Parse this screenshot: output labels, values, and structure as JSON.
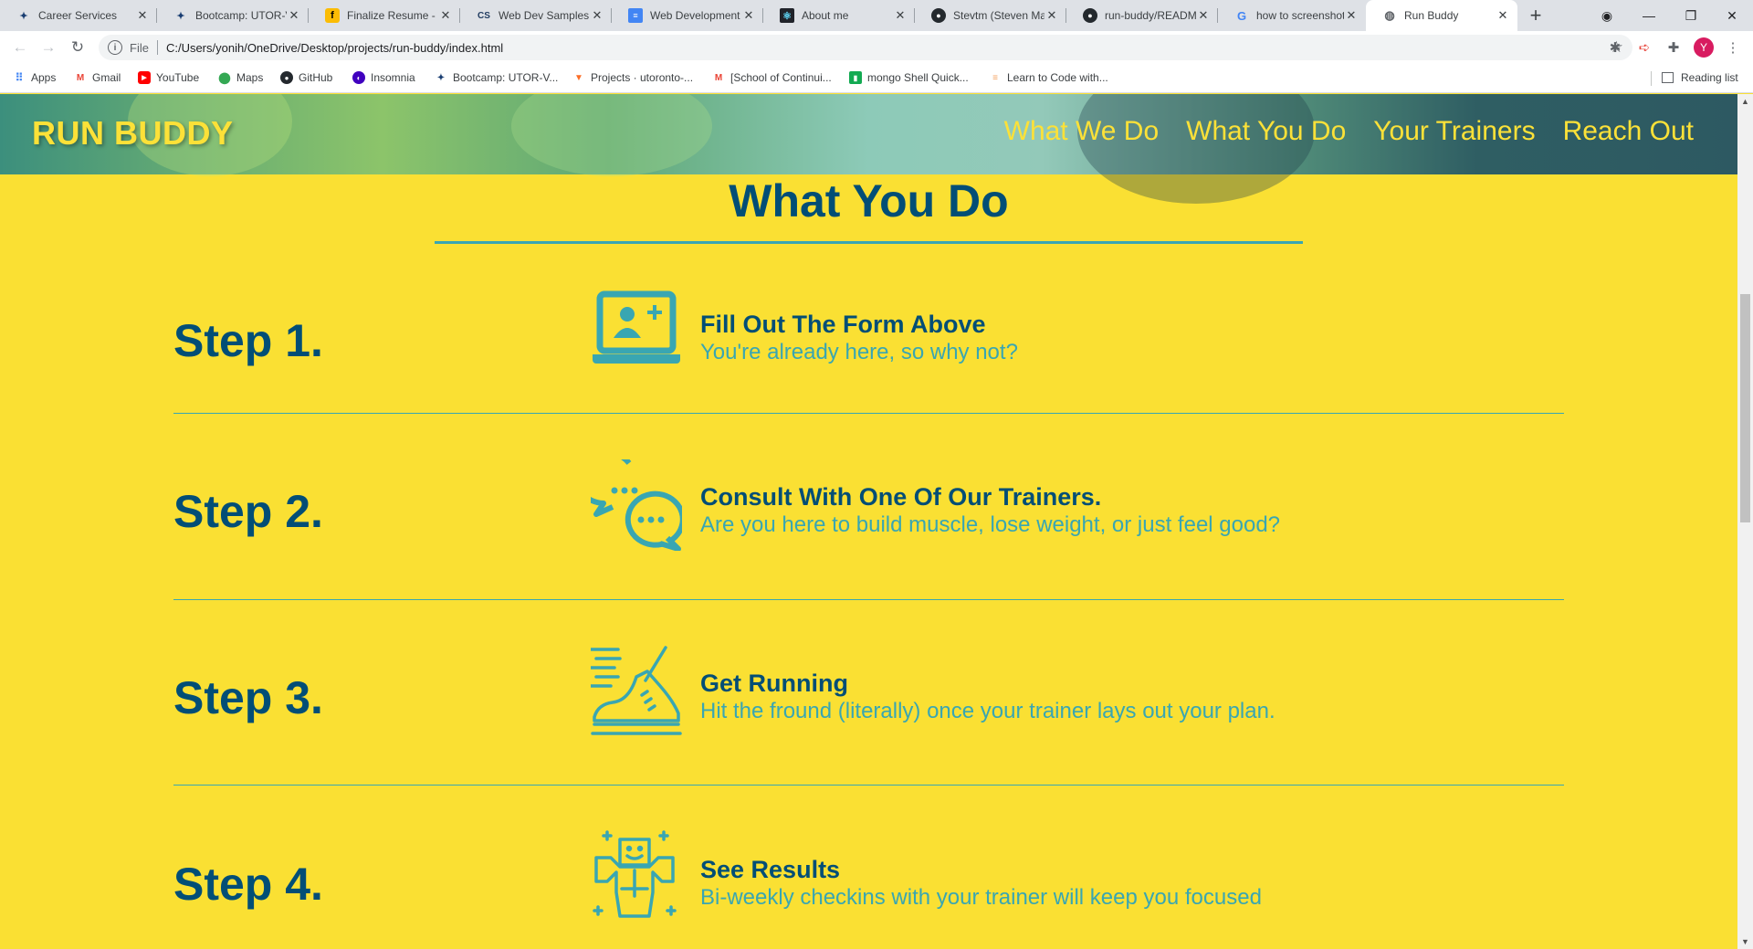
{
  "browser": {
    "tabs": [
      {
        "title": "Career Services",
        "favicon": "bootcamp-icon"
      },
      {
        "title": "Bootcamp: UTOR-V",
        "favicon": "bootcamp-icon"
      },
      {
        "title": "Finalize Resume - F",
        "favicon": "resume-icon"
      },
      {
        "title": "Web Dev Samples",
        "favicon": "cs-icon"
      },
      {
        "title": "Web Development",
        "favicon": "docs-icon"
      },
      {
        "title": "About me",
        "favicon": "react-icon"
      },
      {
        "title": "Stevtm (Steven Ma",
        "favicon": "github-icon"
      },
      {
        "title": "run-buddy/READM",
        "favicon": "github-icon"
      },
      {
        "title": "how to screenshot",
        "favicon": "google-icon"
      },
      {
        "title": "Run Buddy",
        "favicon": "globe-icon",
        "active": true
      }
    ],
    "address": {
      "scheme": "File",
      "url": "C:/Users/yonih/OneDrive/Desktop/projects/run-buddy/index.html"
    },
    "profile_initial": "Y",
    "bookmarks": [
      {
        "label": "Apps",
        "icon": "apps-grid-icon"
      },
      {
        "label": "Gmail",
        "icon": "gmail-icon"
      },
      {
        "label": "YouTube",
        "icon": "youtube-icon"
      },
      {
        "label": "Maps",
        "icon": "maps-icon"
      },
      {
        "label": "GitHub",
        "icon": "github-icon"
      },
      {
        "label": "Insomnia",
        "icon": "insomnia-icon"
      },
      {
        "label": "Bootcamp: UTOR-V...",
        "icon": "bootcamp-icon"
      },
      {
        "label": "Projects · utoronto-...",
        "icon": "gitlab-icon"
      },
      {
        "label": "[School of Continui...",
        "icon": "gmail-icon"
      },
      {
        "label": "mongo Shell Quick...",
        "icon": "mongo-icon"
      },
      {
        "label": "Learn to Code with...",
        "icon": "learn-icon"
      }
    ],
    "reading_list": "Reading list"
  },
  "page": {
    "brand": "RUN BUDDY",
    "nav": [
      "What We Do",
      "What You Do",
      "Your Trainers",
      "Reach Out"
    ],
    "section_title": "What You Do",
    "steps": [
      {
        "number": "Step 1.",
        "title": "Fill Out The Form Above",
        "description": "You're already here, so why not?",
        "icon": "laptop-add-user-icon"
      },
      {
        "number": "Step 2.",
        "title": "Consult With One Of Our Trainers.",
        "description": "Are you here to build muscle, lose weight, or just feel good?",
        "icon": "chat-bubbles-icon"
      },
      {
        "number": "Step 3.",
        "title": "Get Running",
        "description": "Hit the fround (literally) once your trainer lays out your plan.",
        "icon": "running-shoe-icon"
      },
      {
        "number": "Step 4.",
        "title": "See Results",
        "description": "Bi-weekly checkins with your trainer will keep you focused",
        "icon": "strong-person-icon"
      }
    ]
  },
  "colors": {
    "page_background": "#fae033",
    "heading": "#024e76",
    "accent": "#39a6b2",
    "brand_yellow": "#fce138"
  }
}
